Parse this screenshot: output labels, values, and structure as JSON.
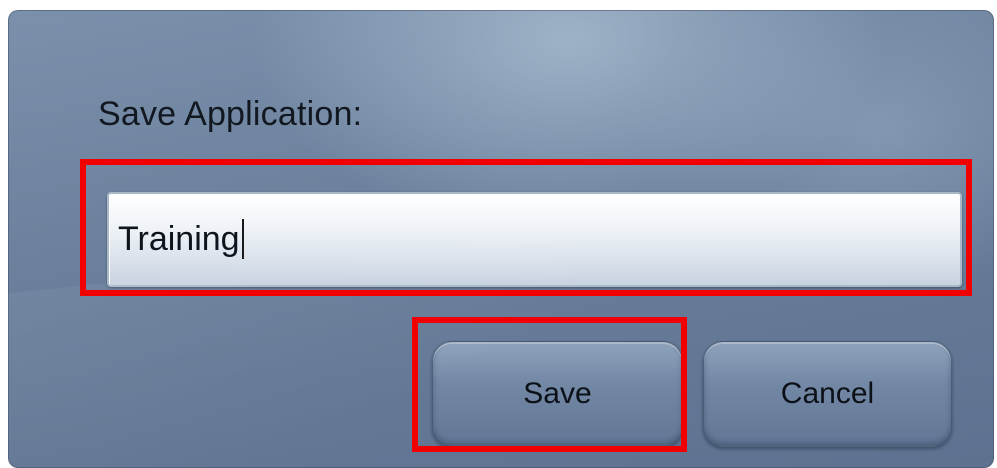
{
  "dialog": {
    "title": "Save Application:",
    "input_value": "Training",
    "save_label": "Save",
    "cancel_label": "Cancel"
  },
  "colors": {
    "highlight": "#f20000",
    "dialog_background": "#6f84a0",
    "text": "#121820"
  }
}
